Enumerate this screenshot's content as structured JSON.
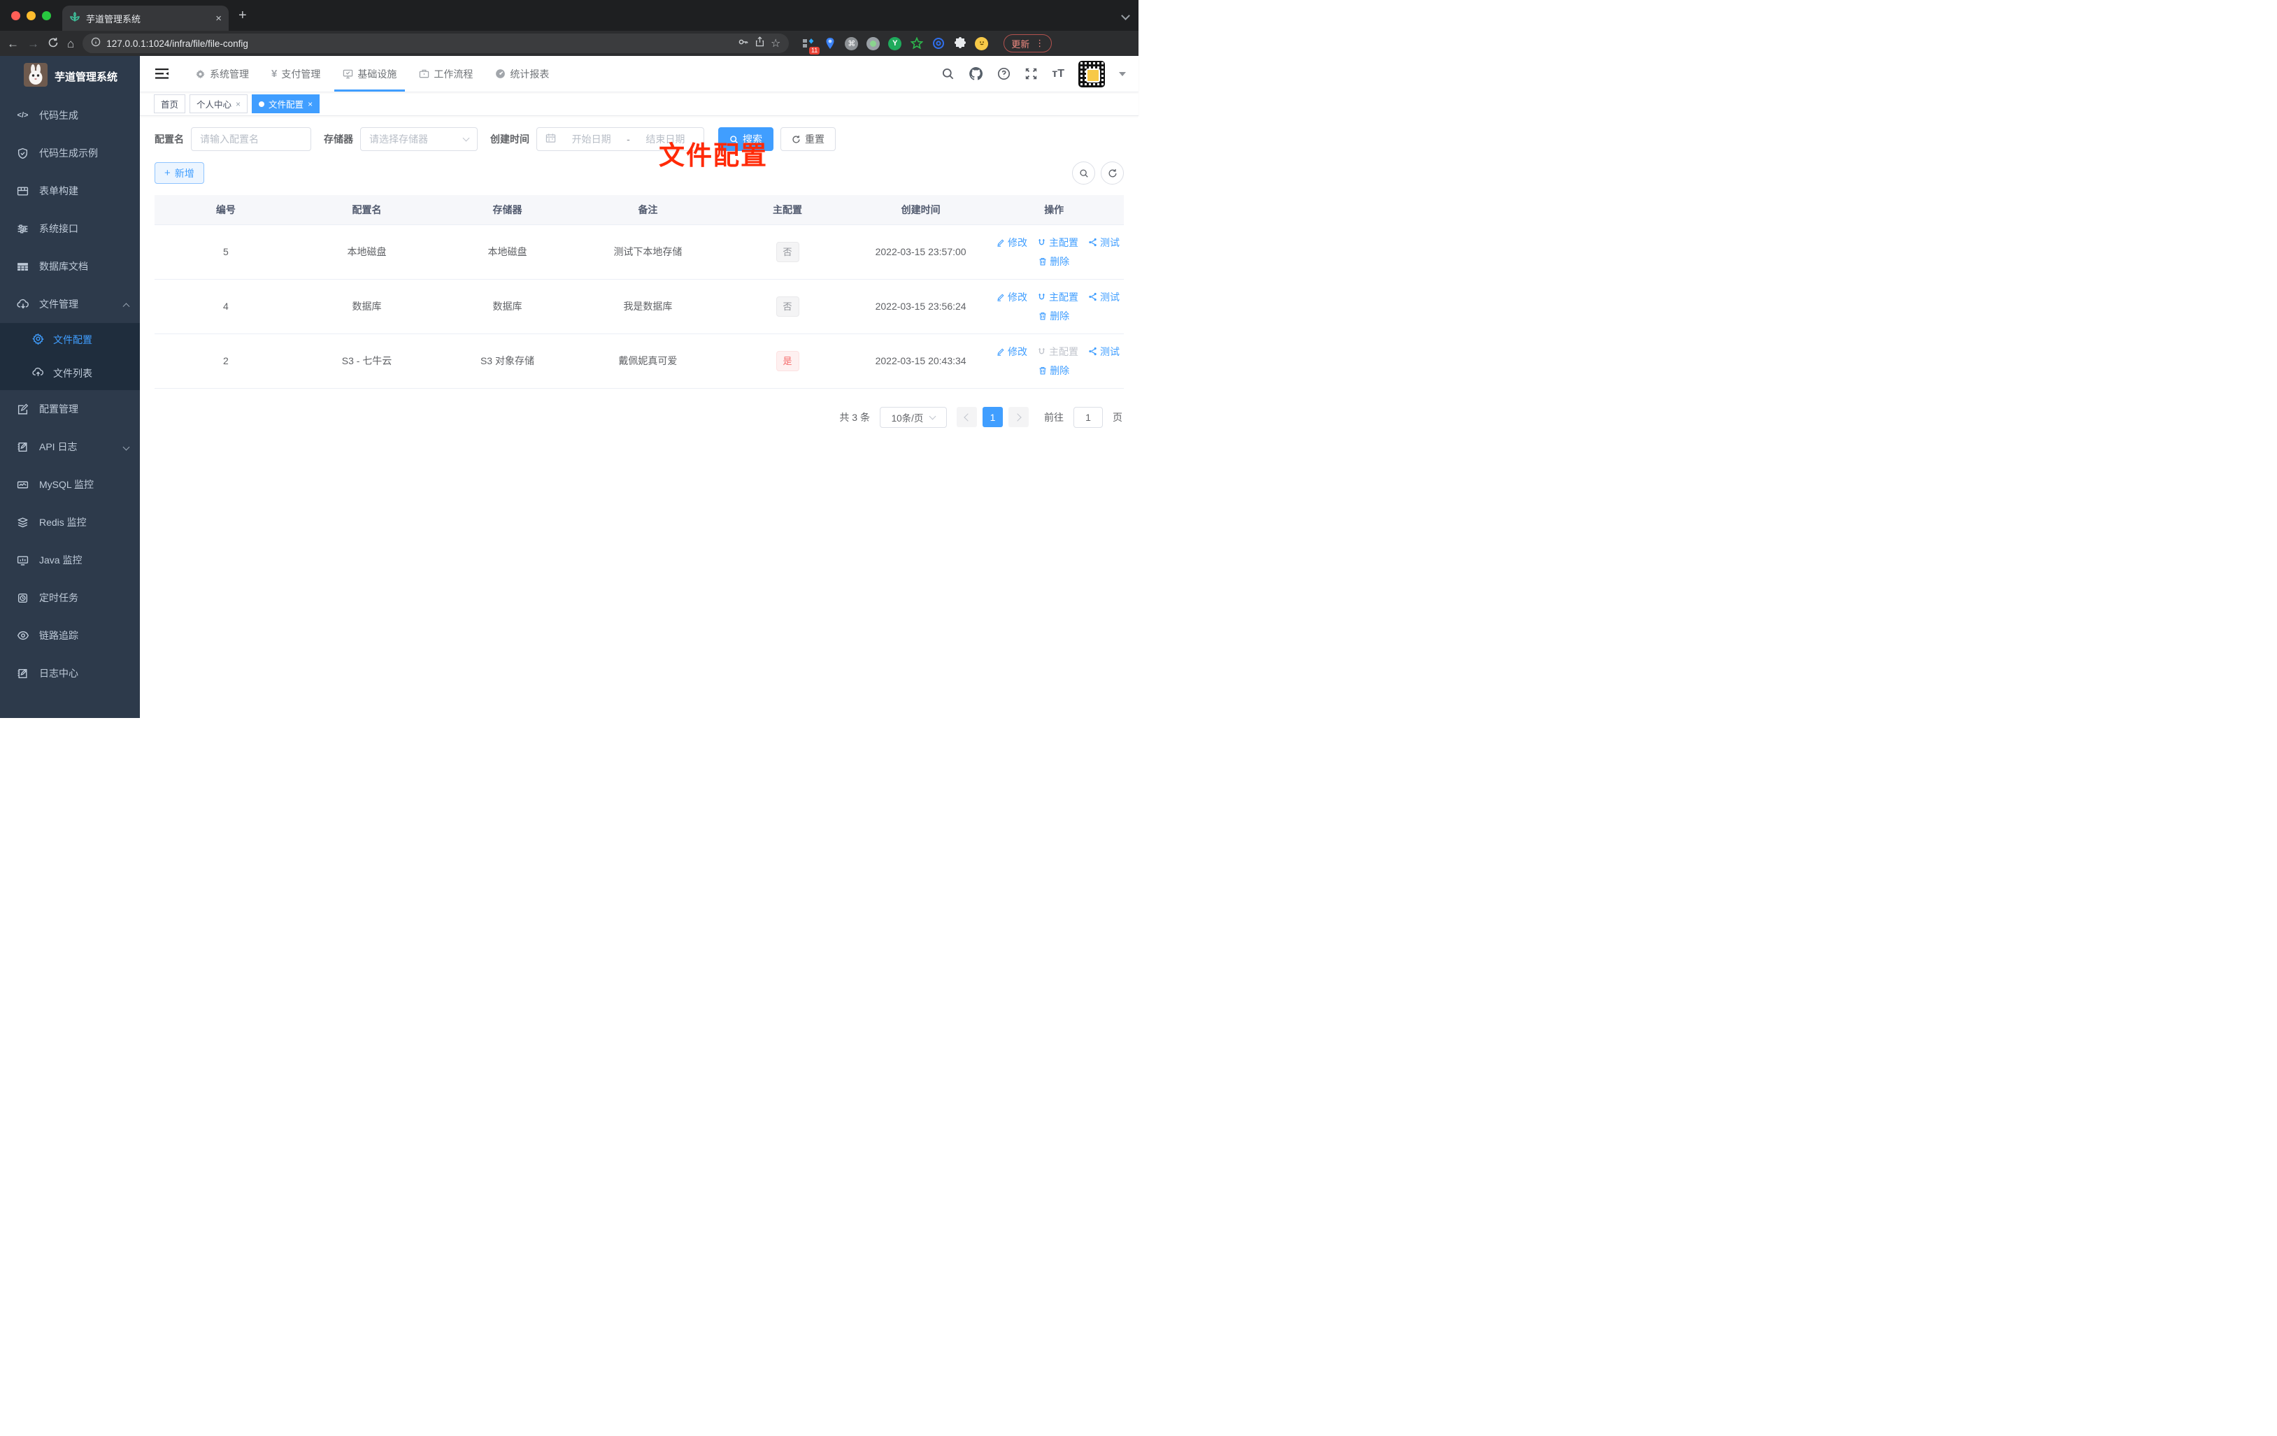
{
  "colors": {
    "primary": "#409eff",
    "sidebar_bg": "#2d3a4b",
    "submenu_bg": "#1f2d3d",
    "danger": "#f56c6c",
    "annotation_red": "#ff2a08"
  },
  "chrome": {
    "tab_title": "芋道管理系统",
    "url": "127.0.0.1:1024/infra/file/file-config",
    "update_label": "更新",
    "ext_badge": "11"
  },
  "sidebar": {
    "title": "芋道管理系统",
    "items": [
      {
        "label": "代码生成",
        "icon": "code-icon"
      },
      {
        "label": "代码生成示例",
        "icon": "shield-check-icon"
      },
      {
        "label": "表单构建",
        "icon": "form-grid-icon"
      },
      {
        "label": "系统接口",
        "icon": "sliders-icon"
      },
      {
        "label": "数据库文档",
        "icon": "database-grid-icon"
      },
      {
        "label": "文件管理",
        "icon": "cloud-download-icon",
        "expanded": true,
        "children": [
          {
            "label": "文件配置",
            "icon": "gear-icon",
            "active": true
          },
          {
            "label": "文件列表",
            "icon": "cloud-upload-icon"
          }
        ]
      },
      {
        "label": "配置管理",
        "icon": "edit-square-icon"
      },
      {
        "label": "API 日志",
        "icon": "log-edit-icon",
        "collapsible": true
      },
      {
        "label": "MySQL 监控",
        "icon": "chart-line-icon"
      },
      {
        "label": "Redis 监控",
        "icon": "layers-icon"
      },
      {
        "label": "Java 监控",
        "icon": "monitor-bars-icon"
      },
      {
        "label": "定时任务",
        "icon": "timer-icon"
      },
      {
        "label": "链路追踪",
        "icon": "eye-icon"
      },
      {
        "label": "日志中心",
        "icon": "log-edit-icon"
      }
    ]
  },
  "topnav": {
    "items": [
      {
        "label": "系统管理",
        "icon": "gear-icon"
      },
      {
        "label": "支付管理",
        "icon": "yen-icon"
      },
      {
        "label": "基础设施",
        "icon": "monitor-check-icon",
        "active": true
      },
      {
        "label": "工作流程",
        "icon": "briefcase-icon"
      },
      {
        "label": "统计报表",
        "icon": "gauge-icon"
      }
    ]
  },
  "tags": {
    "home": "首页",
    "profile": "个人中心",
    "current": "文件配置"
  },
  "annotation": {
    "text": "文件配置"
  },
  "filter": {
    "name_label": "配置名",
    "name_placeholder": "请输入配置名",
    "storage_label": "存储器",
    "storage_placeholder": "请选择存储器",
    "time_label": "创建时间",
    "start_placeholder": "开始日期",
    "range_separator": "-",
    "end_placeholder": "结束日期",
    "search_label": "搜索",
    "reset_label": "重置"
  },
  "toolbar": {
    "add_label": "新增"
  },
  "table": {
    "headers": [
      "编号",
      "配置名",
      "存储器",
      "备注",
      "主配置",
      "创建时间",
      "操作"
    ],
    "actions": {
      "edit": "修改",
      "master": "主配置",
      "test": "测试",
      "delete": "删除"
    },
    "rows": [
      {
        "id": "5",
        "name": "本地磁盘",
        "storage": "本地磁盘",
        "remark": "测试下本地存储",
        "master": "否",
        "master_state": "info",
        "master_action_disabled": false,
        "created": "2022-03-15 23:57:00"
      },
      {
        "id": "4",
        "name": "数据库",
        "storage": "数据库",
        "remark": "我是数据库",
        "master": "否",
        "master_state": "info",
        "master_action_disabled": false,
        "created": "2022-03-15 23:56:24"
      },
      {
        "id": "2",
        "name": "S3 - 七牛云",
        "storage": "S3 对象存储",
        "remark": "戴佩妮真可爱",
        "master": "是",
        "master_state": "danger",
        "master_action_disabled": true,
        "created": "2022-03-15 20:43:34"
      }
    ]
  },
  "pagination": {
    "total": "共 3 条",
    "page_size": "10条/页",
    "page": "1",
    "jump_prefix": "前往",
    "jump_value": "1",
    "jump_suffix": "页"
  }
}
